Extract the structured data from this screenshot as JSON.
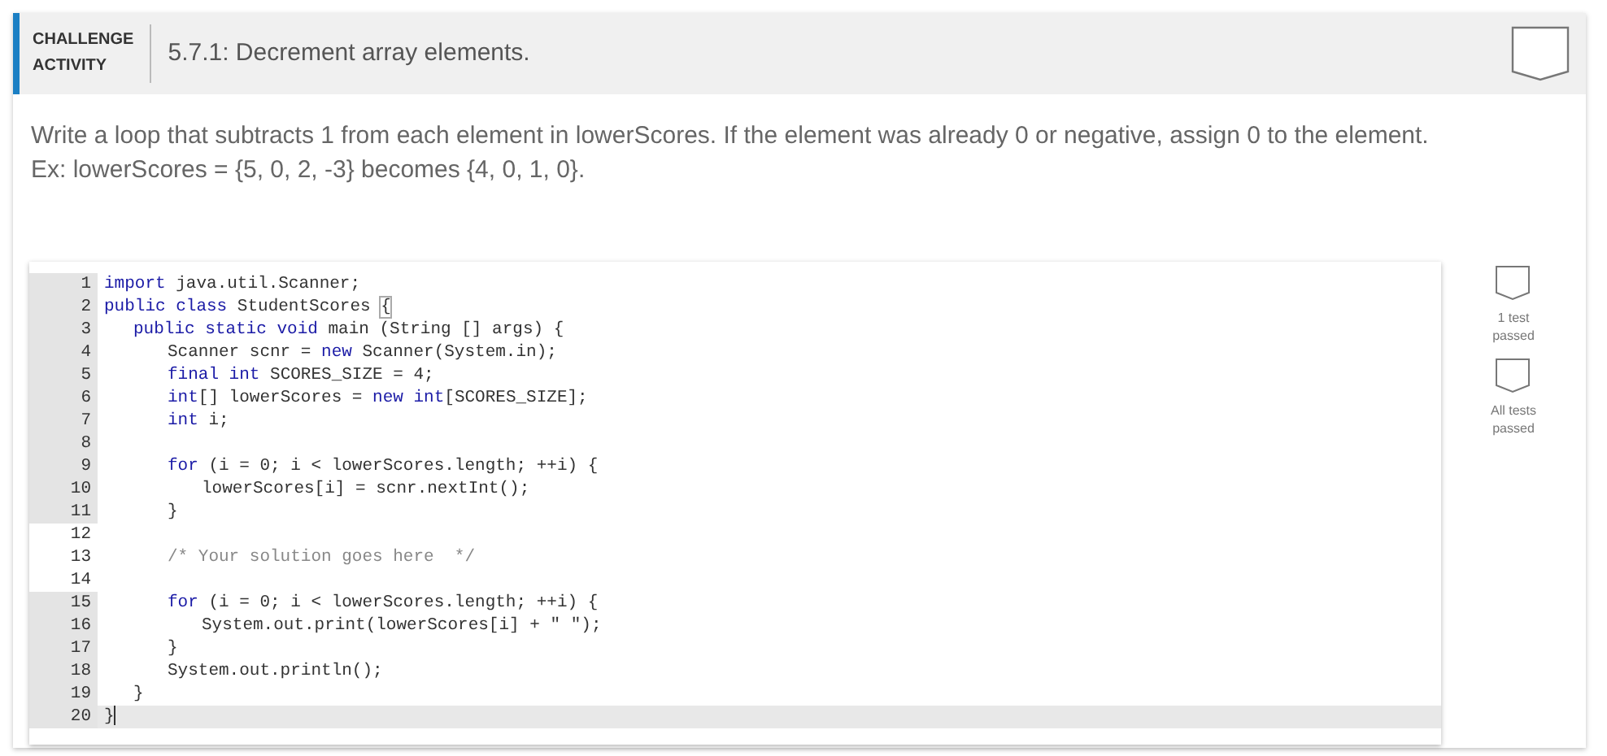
{
  "header": {
    "label_lines": [
      "CHALLENGE",
      "ACTIVITY"
    ],
    "title": "5.7.1: Decrement array elements."
  },
  "description": [
    "Write a loop that subtracts 1 from each element in lowerScores. If the element was already 0 or negative, assign 0 to the element.",
    "Ex: lowerScores = {5, 0, 2, -3} becomes {4, 0, 1, 0}."
  ],
  "code_lines": [
    {
      "number": "1",
      "editable": false,
      "active": false,
      "tokens": [
        {
          "kind": "keyword",
          "text": "import"
        },
        {
          "kind": "plain",
          "text": " java.util.Scanner;"
        }
      ]
    },
    {
      "number": "2",
      "editable": false,
      "active": false,
      "tokens": [
        {
          "kind": "keyword",
          "text": "public class"
        },
        {
          "kind": "plain",
          "text": " StudentScores "
        },
        {
          "kind": "bracket",
          "text": "{"
        }
      ],
      "children": [
        {
          "number": "3",
          "editable": false,
          "active": false,
          "tokens": [
            {
              "kind": "keyword",
              "text": "public static void"
            },
            {
              "kind": "plain",
              "text": " main (String [] args) {"
            }
          ],
          "children": [
            {
              "number": "4",
              "editable": false,
              "active": false,
              "tokens": [
                {
                  "kind": "plain",
                  "text": "Scanner scnr = "
                },
                {
                  "kind": "keyword",
                  "text": "new"
                },
                {
                  "kind": "plain",
                  "text": " Scanner(System.in);"
                }
              ]
            },
            {
              "number": "5",
              "editable": false,
              "active": false,
              "tokens": [
                {
                  "kind": "keyword",
                  "text": "final int"
                },
                {
                  "kind": "plain",
                  "text": " SCORES_SIZE = 4;"
                }
              ]
            },
            {
              "number": "6",
              "editable": false,
              "active": false,
              "tokens": [
                {
                  "kind": "keyword",
                  "text": "int"
                },
                {
                  "kind": "plain",
                  "text": "[] lowerScores = "
                },
                {
                  "kind": "keyword",
                  "text": "new int"
                },
                {
                  "kind": "plain",
                  "text": "[SCORES_SIZE];"
                }
              ]
            },
            {
              "number": "7",
              "editable": false,
              "active": false,
              "tokens": [
                {
                  "kind": "keyword",
                  "text": "int"
                },
                {
                  "kind": "plain",
                  "text": " i;"
                }
              ]
            },
            {
              "number": "8",
              "editable": false,
              "active": false
            },
            {
              "number": "9",
              "editable": false,
              "active": false,
              "tokens": [
                {
                  "kind": "keyword",
                  "text": "for"
                },
                {
                  "kind": "plain",
                  "text": " (i = 0; i < lowerScores.length; ++i) {"
                }
              ],
              "children": [
                {
                  "number": "10",
                  "editable": false,
                  "active": false,
                  "tokens": [
                    {
                      "kind": "plain",
                      "text": "lowerScores[i] = scnr.nextInt();"
                    }
                  ]
                }
              ]
            },
            {
              "number": "11",
              "editable": false,
              "active": false,
              "tokens": [
                {
                  "kind": "plain",
                  "text": "}"
                }
              ]
            },
            {
              "number": "12",
              "editable": true,
              "active": false
            },
            {
              "number": "13",
              "editable": true,
              "active": false,
              "tokens": [
                {
                  "kind": "comment",
                  "text": "/* Your solution goes here  */"
                }
              ]
            },
            {
              "number": "14",
              "editable": true,
              "active": false
            },
            {
              "number": "15",
              "editable": false,
              "active": false,
              "tokens": [
                {
                  "kind": "keyword",
                  "text": "for"
                },
                {
                  "kind": "plain",
                  "text": " (i = 0; i < lowerScores.length; ++i) {"
                }
              ],
              "children": [
                {
                  "number": "16",
                  "editable": false,
                  "active": false,
                  "tokens": [
                    {
                      "kind": "plain",
                      "text": "System.out.print(lowerScores[i] + \" \");"
                    }
                  ]
                }
              ]
            },
            {
              "number": "17",
              "editable": false,
              "active": false,
              "tokens": [
                {
                  "kind": "plain",
                  "text": "}"
                }
              ]
            },
            {
              "number": "18",
              "editable": false,
              "active": false,
              "tokens": [
                {
                  "kind": "plain",
                  "text": "System.out.println();"
                }
              ]
            }
          ]
        },
        {
          "number": "19",
          "editable": false,
          "active": false,
          "tokens": [
            {
              "kind": "plain",
              "text": "}"
            }
          ]
        }
      ]
    },
    {
      "number": "20",
      "editable": false,
      "active": true,
      "tokens": [
        {
          "kind": "plain",
          "text": "}"
        }
      ]
    }
  ],
  "tests": [
    {
      "label_lines": [
        "1 test",
        "passed"
      ]
    },
    {
      "label_lines": [
        "All tests",
        "passed"
      ]
    }
  ]
}
